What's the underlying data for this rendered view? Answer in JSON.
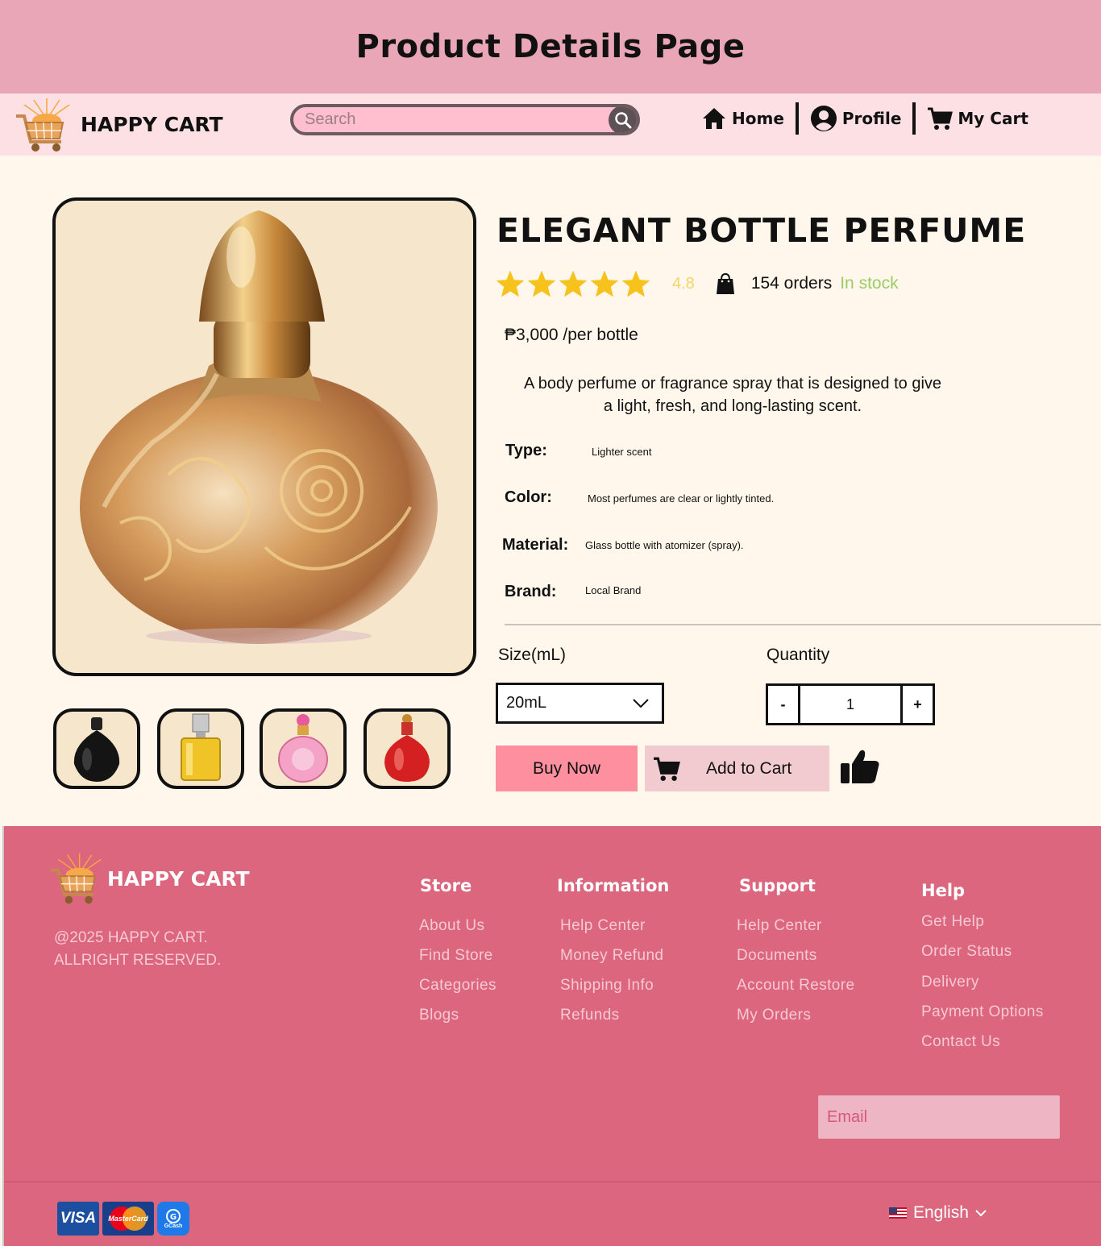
{
  "banner": {
    "title": "Product Details Page"
  },
  "navbar": {
    "brand": "HAPPY CART",
    "search_placeholder": "Search",
    "links": [
      "Home",
      "Profile",
      "My Cart"
    ]
  },
  "product": {
    "title": "ELEGANT BOTTLE PERFUME",
    "rating": "4.8",
    "stars": 5,
    "orders": "154 orders",
    "stock": "In stock",
    "price": "₱3,000 /per bottle",
    "description_line1": "A body perfume or fragrance spray that is designed to give",
    "description_line2": "a light, fresh, and long-lasting scent.",
    "specs": [
      {
        "label": "Type:",
        "value": "Lighter scent"
      },
      {
        "label": "Color:",
        "value": "Most perfumes are clear or lightly tinted."
      },
      {
        "label": "Material:",
        "value": "Glass bottle with atomizer (spray)."
      },
      {
        "label": "Brand:",
        "value": "Local Brand"
      }
    ],
    "size_label": "Size(mL)",
    "size_value": "20mL",
    "quantity_label": "Quantity",
    "quantity_minus": "-",
    "quantity_value": "1",
    "quantity_plus": "+",
    "buy_label": "Buy Now",
    "add_to_cart_label": "Add to Cart",
    "thumbnails": [
      "black-perfume-bottle",
      "yellow-perfume-bottle",
      "pink-perfume-bottle",
      "red-perfume-bottle"
    ]
  },
  "footer": {
    "brand": "HAPPY CART",
    "copyright_line1": "@2025 HAPPY CART.",
    "copyright_line2": "ALLRIGHT RESERVED.",
    "columns": [
      {
        "title": "Store",
        "links": [
          "About Us",
          "Find Store",
          "Categories",
          "Blogs"
        ]
      },
      {
        "title": "Information",
        "links": [
          "Help Center",
          "Money Refund",
          "Shipping Info",
          "Refunds"
        ]
      },
      {
        "title": "Support",
        "links": [
          "Help Center",
          "Documents",
          "Account Restore",
          "My Orders"
        ]
      },
      {
        "title": "Help",
        "links": [
          "Get Help",
          "Order Status",
          "Delivery",
          "Payment Options",
          "Contact Us"
        ]
      }
    ],
    "email_placeholder": "Email",
    "payments": [
      "VISA",
      "MasterCard",
      "GCash"
    ],
    "language": "English"
  },
  "colors": {
    "banner": "#e9a6b6",
    "navbar": "#fde0e4",
    "page_bg": "#fff7ec",
    "footer": "#db667e",
    "buy_button": "#fd8f9f",
    "add_to_cart_button": "#f2cbd1",
    "star": "#f7c21b",
    "stock": "#9ccc65"
  }
}
